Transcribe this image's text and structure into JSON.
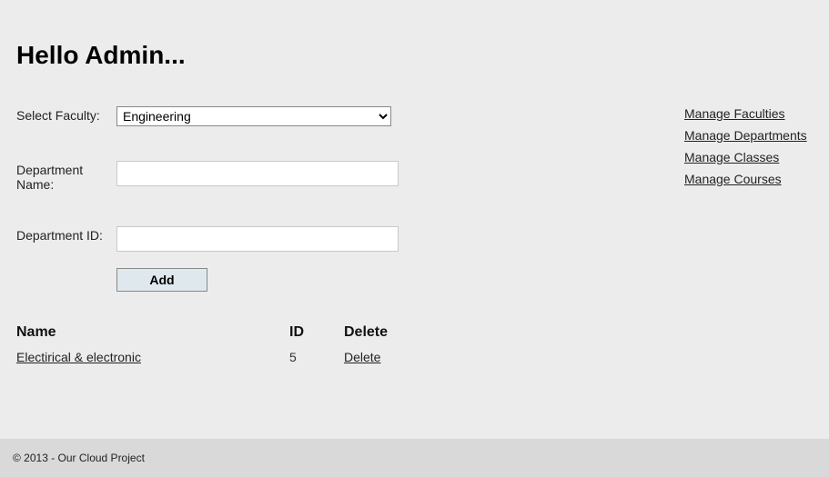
{
  "page": {
    "title": "Hello Admin..."
  },
  "form": {
    "select_faculty_label": "Select Faculty:",
    "faculty_selected": "Engineering",
    "department_name_label": "Department Name:",
    "department_name_value": "",
    "department_id_label": "Department ID:",
    "department_id_value": "",
    "add_button_label": "Add"
  },
  "table": {
    "headers": {
      "name": "Name",
      "id": "ID",
      "delete": "Delete"
    },
    "rows": [
      {
        "name": "Electirical & electronic",
        "id": "5",
        "delete": "Delete"
      }
    ]
  },
  "sidebar": {
    "links": [
      " Manage Faculties",
      " Manage Departments",
      " Manage Classes",
      " Manage Courses"
    ]
  },
  "footer": {
    "text": "© 2013 - Our Cloud Project"
  }
}
